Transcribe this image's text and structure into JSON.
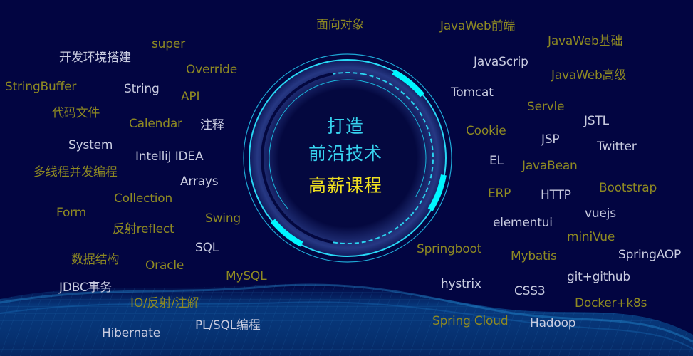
{
  "center": {
    "line1": "打造",
    "line2": "前沿技术",
    "line3": "高薪课程"
  },
  "colors": {
    "background": "#020541",
    "gold": "#8f8a22",
    "white": "#c9cce0",
    "cyan": "#37d2ee",
    "yellow": "#f0e020",
    "ring": "#00f0ff"
  },
  "tags": [
    {
      "text": "面向对象",
      "tone": "gold"
    },
    {
      "text": "JavaWeb前端",
      "tone": "gold"
    },
    {
      "text": "super",
      "tone": "gold"
    },
    {
      "text": "JavaWeb基础",
      "tone": "gold"
    },
    {
      "text": "开发环境搭建",
      "tone": "white"
    },
    {
      "text": "JavaScrip",
      "tone": "white"
    },
    {
      "text": "Override",
      "tone": "gold"
    },
    {
      "text": "JavaWeb高级",
      "tone": "gold"
    },
    {
      "text": "StringBuffer",
      "tone": "gold"
    },
    {
      "text": "String",
      "tone": "white"
    },
    {
      "text": "Tomcat",
      "tone": "white"
    },
    {
      "text": "API",
      "tone": "gold"
    },
    {
      "text": "Servle",
      "tone": "gold"
    },
    {
      "text": "代码文件",
      "tone": "gold"
    },
    {
      "text": "JSTL",
      "tone": "white"
    },
    {
      "text": "Calendar",
      "tone": "gold"
    },
    {
      "text": "注释",
      "tone": "white"
    },
    {
      "text": "Cookie",
      "tone": "gold"
    },
    {
      "text": "JSP",
      "tone": "white"
    },
    {
      "text": "System",
      "tone": "white"
    },
    {
      "text": "Twitter",
      "tone": "white"
    },
    {
      "text": "IntelliJ IDEA",
      "tone": "white"
    },
    {
      "text": "EL",
      "tone": "white"
    },
    {
      "text": "JavaBean",
      "tone": "gold"
    },
    {
      "text": "多线程并发编程",
      "tone": "gold"
    },
    {
      "text": "Arrays",
      "tone": "white"
    },
    {
      "text": "Bootstrap",
      "tone": "gold"
    },
    {
      "text": "ERP",
      "tone": "gold"
    },
    {
      "text": "HTTP",
      "tone": "white"
    },
    {
      "text": "Collection",
      "tone": "gold"
    },
    {
      "text": "Form",
      "tone": "gold"
    },
    {
      "text": "vuejs",
      "tone": "white"
    },
    {
      "text": "Swing",
      "tone": "gold"
    },
    {
      "text": "elementui",
      "tone": "white"
    },
    {
      "text": "反射reflect",
      "tone": "gold"
    },
    {
      "text": "miniVue",
      "tone": "gold"
    },
    {
      "text": "SQL",
      "tone": "white"
    },
    {
      "text": "Springboot",
      "tone": "gold"
    },
    {
      "text": "SpringAOP",
      "tone": "white"
    },
    {
      "text": "数据结构",
      "tone": "gold"
    },
    {
      "text": "Mybatis",
      "tone": "gold"
    },
    {
      "text": "Oracle",
      "tone": "gold"
    },
    {
      "text": "MySQL",
      "tone": "gold"
    },
    {
      "text": "git+github",
      "tone": "white"
    },
    {
      "text": "hystrix",
      "tone": "white"
    },
    {
      "text": "JDBC事务",
      "tone": "white"
    },
    {
      "text": "CSS3",
      "tone": "white"
    },
    {
      "text": "IO/反射/注解",
      "tone": "gold"
    },
    {
      "text": "Docker+k8s",
      "tone": "gold"
    },
    {
      "text": "Spring Cloud",
      "tone": "gold"
    },
    {
      "text": "Hadoop",
      "tone": "white"
    },
    {
      "text": "PL/SQL编程",
      "tone": "white"
    },
    {
      "text": "Hibernate",
      "tone": "white"
    }
  ]
}
